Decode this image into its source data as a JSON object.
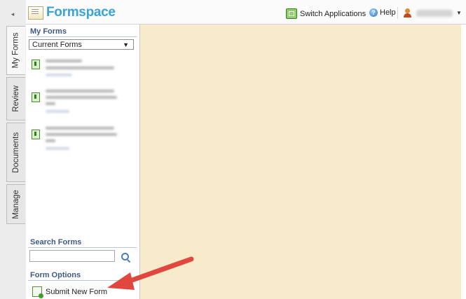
{
  "window": {
    "collapse_glyph": "◂"
  },
  "header": {
    "logo_text": "Formspace",
    "switch_applications_label": "Switch Applications",
    "help_label": "Help"
  },
  "vertical_tabs": [
    {
      "label": "My Forms",
      "active": true
    },
    {
      "label": "Review",
      "active": false
    },
    {
      "label": "Documents",
      "active": false
    },
    {
      "label": "Manage",
      "active": false
    }
  ],
  "panel": {
    "my_forms_title": "My Forms",
    "forms_filter_selected": "Current Forms",
    "search_forms_title": "Search Forms",
    "search_value": "",
    "form_options_title": "Form Options",
    "submit_new_form_label": "Submit New Form"
  },
  "colors": {
    "accent": "#3ba3d6",
    "section_title": "#3e5a86",
    "content_bg": "#f7ebcc",
    "arrow": "#e2473f"
  }
}
